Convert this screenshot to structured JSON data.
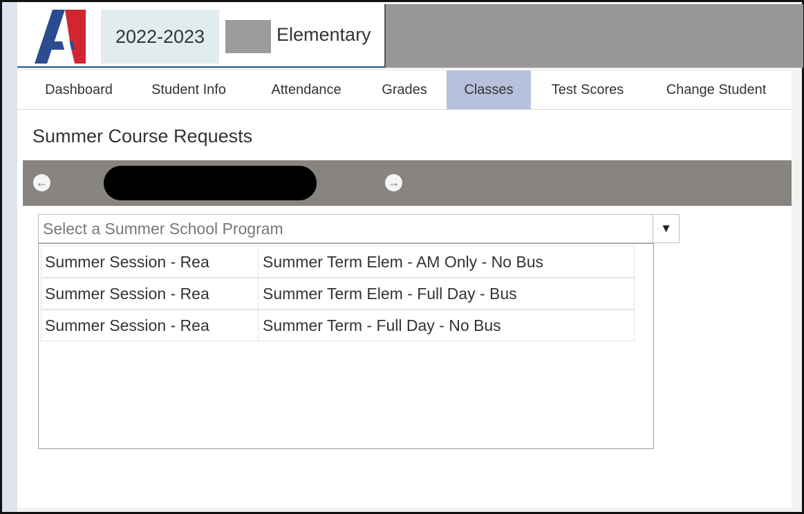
{
  "header": {
    "school_year": "2022-2023",
    "school_name": "Elementary",
    "colors": {
      "brand_blue": "#2b4d8f",
      "brand_red": "#d12630",
      "accent": "#b7c0dc"
    }
  },
  "nav": {
    "items": [
      {
        "label": "Dashboard",
        "active": false
      },
      {
        "label": "Student Info",
        "active": false
      },
      {
        "label": "Attendance",
        "active": false
      },
      {
        "label": "Grades",
        "active": false
      },
      {
        "label": "Classes",
        "active": true
      },
      {
        "label": "Test Scores",
        "active": false
      },
      {
        "label": "Change Student",
        "active": false
      }
    ]
  },
  "page": {
    "title": "Summer Course Requests"
  },
  "student_nav": {
    "prev_icon": "arrow-left-circle-icon",
    "next_icon": "arrow-right-circle-icon"
  },
  "program_select": {
    "placeholder": "Select a Summer School Program",
    "caret": "▼",
    "options": [
      {
        "session": "Summer Session - Rea",
        "term": "Summer Term Elem - AM Only - No Bus"
      },
      {
        "session": "Summer Session - Rea",
        "term": "Summer Term Elem - Full Day - Bus"
      },
      {
        "session": "Summer Session - Rea",
        "term": "Summer Term - Full Day - No Bus"
      }
    ]
  }
}
